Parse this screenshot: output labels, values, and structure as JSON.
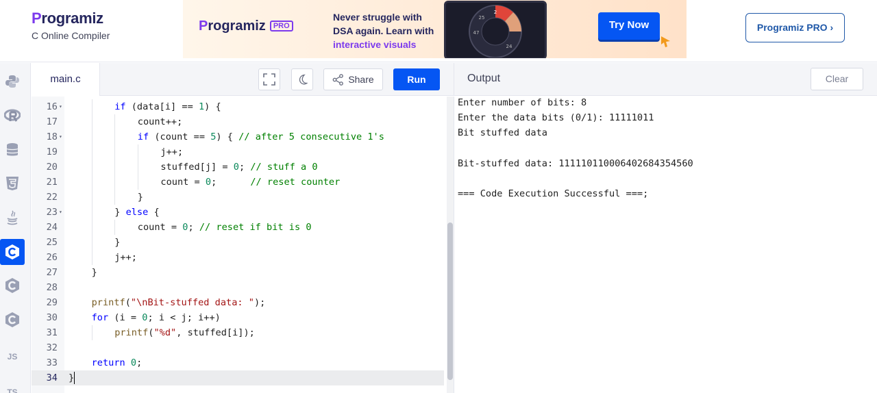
{
  "header": {
    "logo_prefix": "P",
    "logo_rest": "rogramiz",
    "subtitle": "C Online Compiler",
    "pro_button": "Programiz PRO ›"
  },
  "ad": {
    "logo_prefix": "P",
    "logo_rest": "rogramiz",
    "logo_badge": "PRO",
    "line1": "Never struggle with",
    "line2": "DSA again. Learn with",
    "line3": "interactive visuals",
    "button": "Try Now"
  },
  "sidebar": {
    "items": [
      {
        "name": "python",
        "icon": "python-icon",
        "active": false
      },
      {
        "name": "r",
        "icon": "r-icon",
        "active": false
      },
      {
        "name": "sql",
        "icon": "database-icon",
        "active": false
      },
      {
        "name": "html",
        "icon": "html5-icon",
        "active": false
      },
      {
        "name": "java",
        "icon": "java-icon",
        "active": false
      },
      {
        "name": "c",
        "icon": "c-icon",
        "active": true
      },
      {
        "name": "cpp",
        "icon": "cpp-icon",
        "active": false
      },
      {
        "name": "csharp",
        "icon": "csharp-icon",
        "active": false
      },
      {
        "name": "js",
        "label": "JS",
        "icon": "js-icon",
        "active": false
      },
      {
        "name": "ts",
        "label": "TS",
        "icon": "ts-icon",
        "active": false
      }
    ]
  },
  "editor": {
    "file_tab": "main.c",
    "share_label": "Share",
    "run_label": "Run",
    "current_line": 34,
    "lines": [
      {
        "n": "16",
        "fold": true,
        "indent": 2,
        "code": "if (data[i] == 1) {"
      },
      {
        "n": "17",
        "fold": false,
        "indent": 3,
        "code": "count++;"
      },
      {
        "n": "18",
        "fold": true,
        "indent": 3,
        "code": "if (count == 5) { // after 5 consecutive 1's"
      },
      {
        "n": "19",
        "fold": false,
        "indent": 4,
        "code": "j++;"
      },
      {
        "n": "20",
        "fold": false,
        "indent": 4,
        "code": "stuffed[j] = 0; // stuff a 0"
      },
      {
        "n": "21",
        "fold": false,
        "indent": 4,
        "code": "count = 0;      // reset counter"
      },
      {
        "n": "22",
        "fold": false,
        "indent": 3,
        "code": "}"
      },
      {
        "n": "23",
        "fold": true,
        "indent": 2,
        "code": "} else {"
      },
      {
        "n": "24",
        "fold": false,
        "indent": 3,
        "code": "count = 0; // reset if bit is 0"
      },
      {
        "n": "25",
        "fold": false,
        "indent": 2,
        "code": "}"
      },
      {
        "n": "26",
        "fold": false,
        "indent": 2,
        "code": "j++;"
      },
      {
        "n": "27",
        "fold": false,
        "indent": 1,
        "code": "}"
      },
      {
        "n": "28",
        "fold": false,
        "indent": 0,
        "code": ""
      },
      {
        "n": "29",
        "fold": false,
        "indent": 1,
        "code": "printf(\"\\nBit-stuffed data: \");"
      },
      {
        "n": "30",
        "fold": false,
        "indent": 1,
        "code": "for (i = 0; i < j; i++)"
      },
      {
        "n": "31",
        "fold": false,
        "indent": 2,
        "code": "printf(\"%d\", stuffed[i]);"
      },
      {
        "n": "32",
        "fold": false,
        "indent": 0,
        "code": ""
      },
      {
        "n": "33",
        "fold": false,
        "indent": 1,
        "code": "return 0;"
      },
      {
        "n": "34",
        "fold": false,
        "indent": 0,
        "code": "}"
      }
    ]
  },
  "output": {
    "title": "Output",
    "clear_label": "Clear",
    "lines": [
      "Enter number of bits: 8",
      "Enter the data bits (0/1): 11111011",
      "Bit stuffed data",
      "",
      "Bit-stuffed data: 1111101100064026843545​60",
      "",
      "=== Code Execution Successful ===;"
    ]
  },
  "colors": {
    "accent": "#0556f3",
    "brand_purple": "#7c3aed",
    "text_dark": "#25265e"
  }
}
